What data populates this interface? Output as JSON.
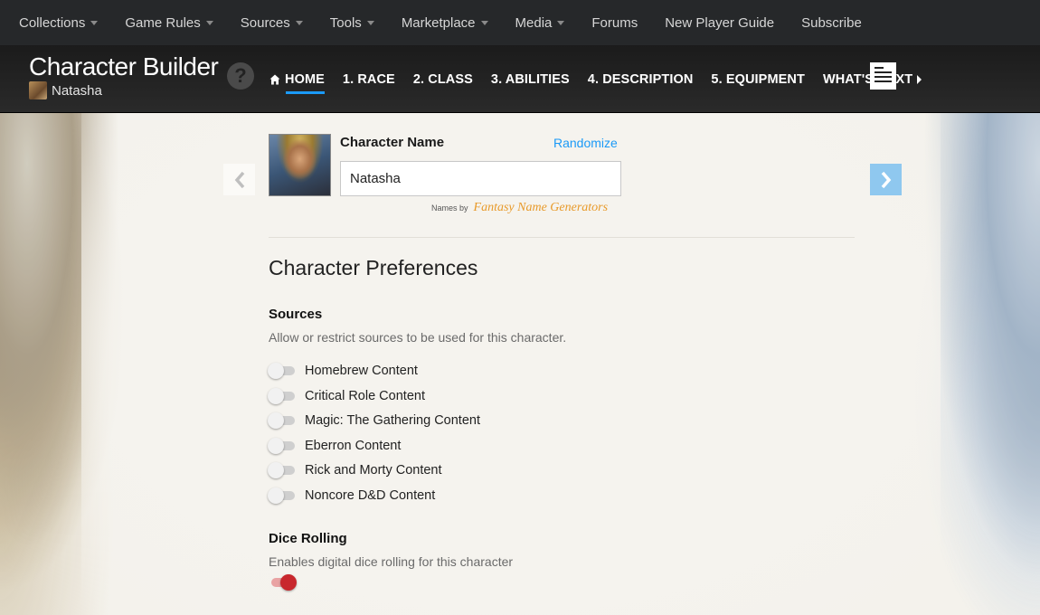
{
  "topnav": {
    "items": [
      {
        "label": "Collections",
        "dropdown": true
      },
      {
        "label": "Game Rules",
        "dropdown": true
      },
      {
        "label": "Sources",
        "dropdown": true
      },
      {
        "label": "Tools",
        "dropdown": true
      },
      {
        "label": "Marketplace",
        "dropdown": true
      },
      {
        "label": "Media",
        "dropdown": true
      },
      {
        "label": "Forums",
        "dropdown": false
      },
      {
        "label": "New Player Guide",
        "dropdown": false
      },
      {
        "label": "Subscribe",
        "dropdown": false
      }
    ]
  },
  "header": {
    "title": "Character Builder",
    "character_name": "Natasha",
    "help_glyph": "?",
    "steps": [
      {
        "label": "HOME",
        "active": true
      },
      {
        "label": "1. RACE",
        "active": false
      },
      {
        "label": "2. CLASS",
        "active": false
      },
      {
        "label": "3. ABILITIES",
        "active": false
      },
      {
        "label": "4. DESCRIPTION",
        "active": false
      },
      {
        "label": "5. EQUIPMENT",
        "active": false
      },
      {
        "label": "WHAT'S NEXT",
        "active": false
      }
    ]
  },
  "name_section": {
    "label": "Character Name",
    "randomize_label": "Randomize",
    "value": "Natasha",
    "names_by": "Names by",
    "generator": "Fantasy Name Generators"
  },
  "preferences": {
    "title": "Character Preferences",
    "sources": {
      "title": "Sources",
      "description": "Allow or restrict sources to be used for this character.",
      "options": [
        {
          "label": "Homebrew Content",
          "enabled": false
        },
        {
          "label": "Critical Role Content",
          "enabled": false
        },
        {
          "label": "Magic: The Gathering Content",
          "enabled": false
        },
        {
          "label": "Eberron Content",
          "enabled": false
        },
        {
          "label": "Rick and Morty Content",
          "enabled": false
        },
        {
          "label": "Noncore D&D Content",
          "enabled": false
        }
      ]
    },
    "dice": {
      "title": "Dice Rolling",
      "description": "Enables digital dice rolling for this character",
      "enabled": true
    }
  },
  "colors": {
    "accent": "#1b9af7",
    "toggle_on": "#c8272d",
    "topnav_bg": "#26282a"
  }
}
